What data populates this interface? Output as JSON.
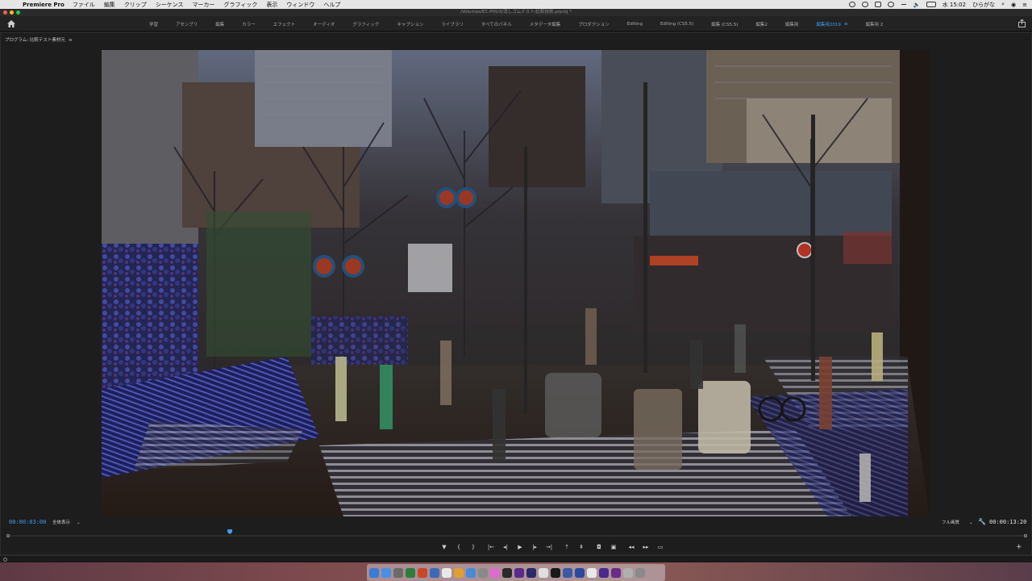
{
  "menubar": {
    "app_name": "Premiere Pro",
    "items": [
      "ファイル",
      "編集",
      "クリップ",
      "シーケンス",
      "マーカー",
      "グラフィック",
      "表示",
      "ウィンドウ",
      "ヘルプ"
    ],
    "clock": "水 15:02",
    "input_mode": "ひらがな"
  },
  "window": {
    "title": "/Volumes/EC-PHU3/消しゴムテスト/比較技術.prproj *"
  },
  "workspaces": {
    "tabs": [
      "学習",
      "アセンブリ",
      "編集",
      "カラー",
      "エフェクト",
      "オーディオ",
      "グラフィック",
      "キャプション",
      "ライブラリ",
      "すべてのパネル",
      "メタデータ編集",
      "プロダクション",
      "Editing",
      "Editing (CS5.5)",
      "編集 (CS5.5)",
      "編集2",
      "編集用",
      "編集用2019",
      "編集用 2"
    ],
    "active_index": 17,
    "accent": "#3f9bf0"
  },
  "monitor": {
    "panel_title": "プログラム: 比較テスト素材元",
    "panel_menu_glyph": "≡",
    "timecode_current": "00:00:03:00",
    "fit_label": "全体表示",
    "quality_label": "フル画質",
    "timecode_duration": "00:00:13:20",
    "playhead_fraction": 0.218
  },
  "transport": {
    "buttons": [
      {
        "name": "add-marker-button",
        "glyph": "▼"
      },
      {
        "name": "mark-in-button",
        "glyph": "{"
      },
      {
        "name": "mark-out-button",
        "glyph": "}"
      },
      {
        "name": "go-to-in-button",
        "glyph": "|←"
      },
      {
        "name": "step-back-button",
        "glyph": "◂|"
      },
      {
        "name": "play-button",
        "glyph": "▶"
      },
      {
        "name": "step-forward-button",
        "glyph": "|▸"
      },
      {
        "name": "go-to-out-button",
        "glyph": "→|"
      },
      {
        "name": "lift-button",
        "glyph": "⇡"
      },
      {
        "name": "extract-button",
        "glyph": "⇞"
      },
      {
        "name": "export-frame-button",
        "glyph": "◘"
      },
      {
        "name": "comparison-view-button",
        "glyph": "▣"
      },
      {
        "name": "trim-back-button",
        "glyph": "◂◂"
      },
      {
        "name": "trim-forward-button",
        "glyph": "▸▸"
      },
      {
        "name": "safe-margins-button",
        "glyph": "▭"
      }
    ],
    "add_button_glyph": "+"
  }
}
